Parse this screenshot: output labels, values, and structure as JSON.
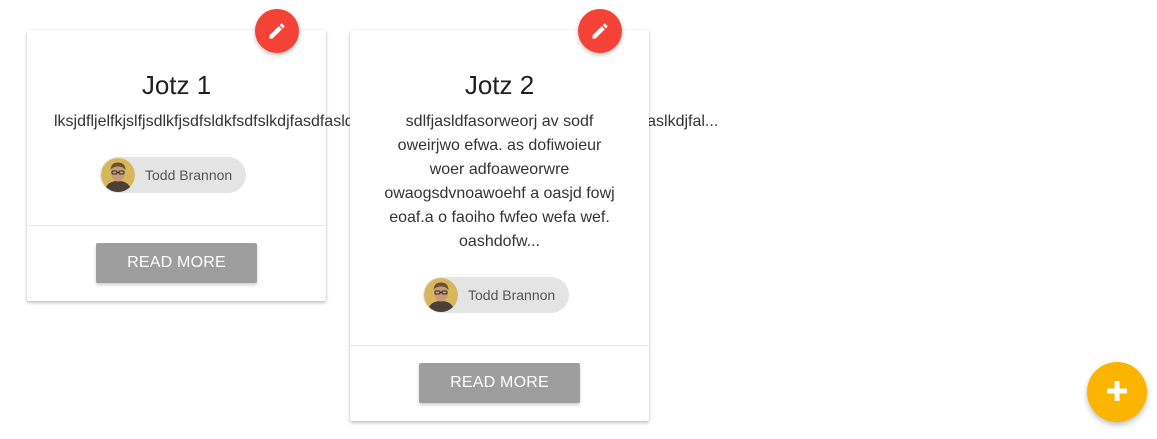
{
  "colors": {
    "edit_fab": "#f44336",
    "add_fab": "#fbb400",
    "read_more_button": "#9e9e9e",
    "author_chip": "#e4e4e4"
  },
  "cards": [
    {
      "title": "Jotz 1",
      "text": "lksjdfljelfkjslfjsdlkfjsdfsldkfsdfslkdjfasdfasldfjasldfjasldfjasldkfjasldfjasldjfaslkdjfalskdjfaslkdjfal...",
      "author": "Todd Brannon",
      "read_more_label": "READ MORE",
      "edit_icon": "pencil-icon",
      "avatar_icon": "avatar-photo"
    },
    {
      "title": "Jotz 2",
      "text_lines": [
        "sdlfjasldfasorweorj av sodf",
        "oweirjwo efwa. as dofiwoieur",
        "woer adfoaweorwre",
        "owaogsdvnoawoehf a oasjd fowj",
        "eoaf.a o faoiho fwfeo wefa wef.",
        "oashdofw..."
      ],
      "author": "Todd Brannon",
      "read_more_label": "READ MORE",
      "edit_icon": "pencil-icon",
      "avatar_icon": "avatar-photo"
    }
  ],
  "add_fab": {
    "icon": "plus-icon"
  }
}
